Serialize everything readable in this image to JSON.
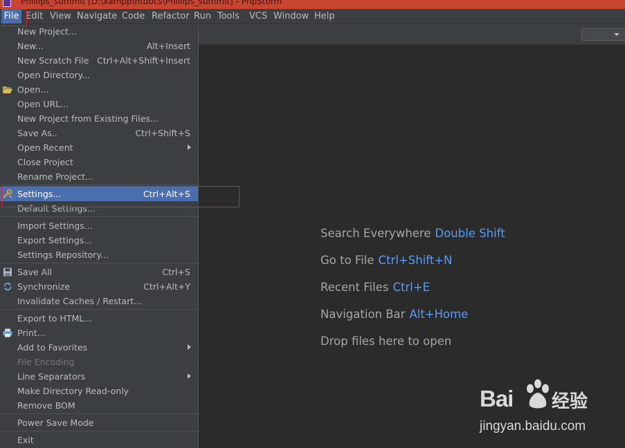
{
  "window": {
    "title": "Phillips_summit [D:\\xampp\\htdocs\\Phillips_summit] - PhpStorm"
  },
  "menubar": {
    "items": [
      "File",
      "Edit",
      "View",
      "Navigate",
      "Code",
      "Refactor",
      "Run",
      "Tools",
      "VCS",
      "Window",
      "Help"
    ]
  },
  "file_menu": {
    "new_project": "New Project...",
    "new": "New...",
    "new_shortcut": "Alt+Insert",
    "new_scratch": "New Scratch File",
    "new_scratch_shortcut": "Ctrl+Alt+Shift+Insert",
    "open_directory": "Open Directory...",
    "open": "Open...",
    "open_url": "Open URL...",
    "new_from_existing": "New Project from Existing Files...",
    "save_as": "Save As..",
    "save_as_shortcut": "Ctrl+Shift+S",
    "open_recent": "Open Recent",
    "close_project": "Close Project",
    "rename_project": "Rename Project...",
    "settings": "Settings...",
    "settings_shortcut": "Ctrl+Alt+S",
    "default_settings": "Default Settings...",
    "import_settings": "Import Settings...",
    "export_settings": "Export Settings...",
    "settings_repository": "Settings Repository...",
    "save_all": "Save All",
    "save_all_shortcut": "Ctrl+S",
    "synchronize": "Synchronize",
    "synchronize_shortcut": "Ctrl+Alt+Y",
    "invalidate_caches": "Invalidate Caches / Restart...",
    "export_html": "Export to HTML...",
    "print": "Print...",
    "add_favorites": "Add to Favorites",
    "file_encoding": "File Encoding",
    "line_separators": "Line Separators",
    "make_readonly": "Make Directory Read-only",
    "remove_bom": "Remove BOM",
    "power_save": "Power Save Mode",
    "exit": "Exit"
  },
  "welcome_hints": [
    {
      "label": "Search Everywhere",
      "key": "Double Shift"
    },
    {
      "label": "Go to File",
      "key": "Ctrl+Shift+N"
    },
    {
      "label": "Recent Files",
      "key": "Ctrl+E"
    },
    {
      "label": "Navigation Bar",
      "key": "Alt+Home"
    },
    {
      "label": "Drop files here to open",
      "key": ""
    }
  ],
  "watermark": {
    "logo": "Bai",
    "logo2": "经验",
    "url": "jingyan.baidu.com"
  },
  "colors": {
    "background": "#2b2b2b",
    "menu_bg": "#3c3f41",
    "selection": "#4b6eaf",
    "hint_key": "#589df6",
    "highlight_box": "#e3202a"
  }
}
